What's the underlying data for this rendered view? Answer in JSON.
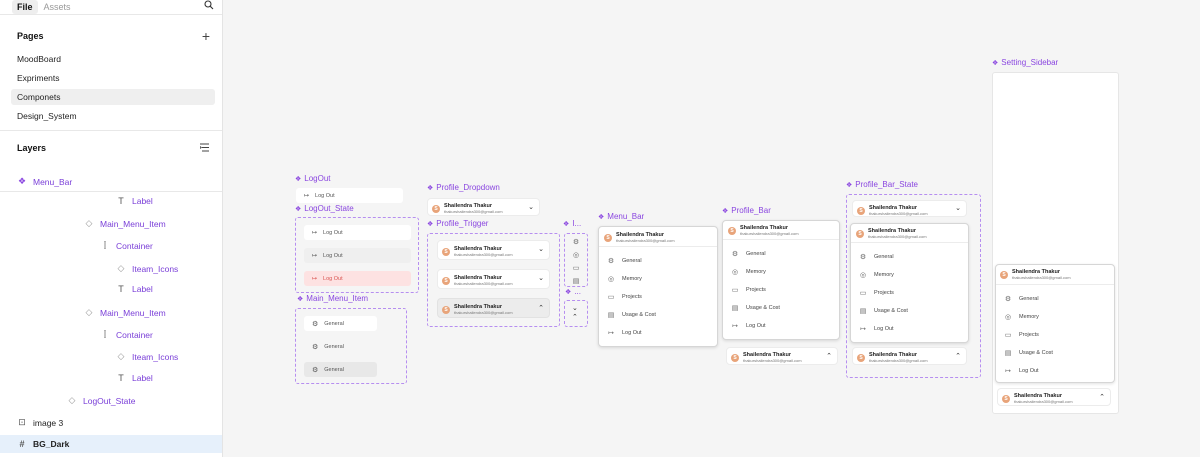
{
  "panel": {
    "tabs": [
      "File",
      "Assets"
    ],
    "pages_title": "Pages",
    "pages": [
      "MoodBoard",
      "Expriments",
      "Componets",
      "Design_System"
    ],
    "selected_page": "Componets",
    "layers_title": "Layers",
    "layers": [
      {
        "label": "Menu_Bar",
        "icon": "component-icon"
      },
      {
        "label": "Label",
        "icon": "text-icon"
      },
      {
        "label": "Main_Menu_Item",
        "icon": "instance-icon"
      },
      {
        "label": "Container",
        "icon": "frame-icon"
      },
      {
        "label": "Iteam_Icons",
        "icon": "instance-icon"
      },
      {
        "label": "Label",
        "icon": "text-icon"
      },
      {
        "label": "Main_Menu_Item",
        "icon": "instance-icon"
      },
      {
        "label": "Container",
        "icon": "frame-icon"
      },
      {
        "label": "Iteam_Icons",
        "icon": "instance-icon"
      },
      {
        "label": "Label",
        "icon": "text-icon"
      },
      {
        "label": "LogOut_State",
        "icon": "instance-icon"
      },
      {
        "label": "image 3",
        "icon": "image-icon"
      },
      {
        "label": "BG_Dark",
        "icon": "frame-grid-icon"
      }
    ]
  },
  "canvas": {
    "labels": {
      "logout": "LogOut",
      "logout_state": "LogOut_State",
      "main_menu_item": "Main_Menu_Item",
      "profile_dropdown": "Profile_Dropdown",
      "profile_trigger": "Profile_Trigger",
      "icons_short": "I...",
      "menu_bar": "Menu_Bar",
      "profile_bar": "Profile_Bar",
      "profile_bar_state": "Profile_Bar_State",
      "setting_sidebar": "Setting_Sidebar"
    },
    "logout_text": "Log Out",
    "general_text": "General",
    "profile": {
      "initial": "S",
      "name": "Shailendra Thakur",
      "email": "thakurshailendra300@gmail.com"
    },
    "menu_items": [
      "General",
      "Memory",
      "Projects",
      "Usage & Cost",
      "Log Out"
    ],
    "colors": {
      "accent": "#8a46e0",
      "danger_bg": "#fde2e2",
      "danger_text": "#d9534f"
    }
  }
}
